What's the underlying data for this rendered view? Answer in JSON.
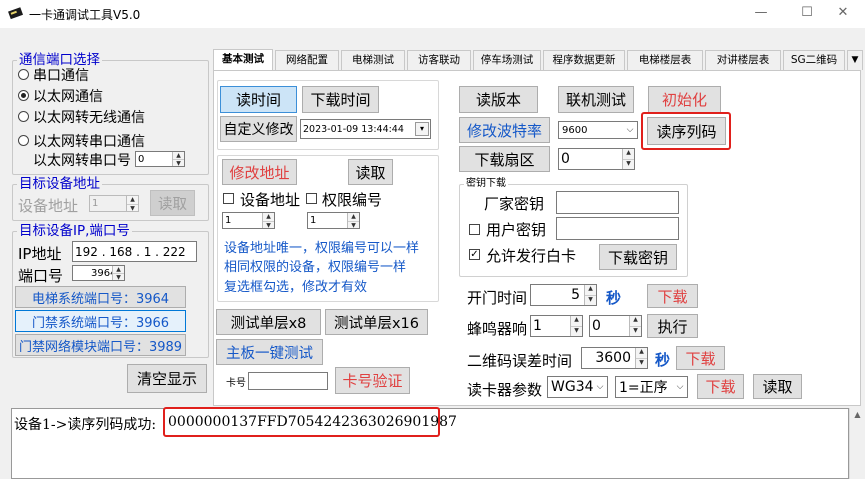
{
  "window": {
    "title": "一卡通调试工具V5.0",
    "minimize": "—",
    "maximize": "☐",
    "close": "✕"
  },
  "left": {
    "comm_group": "通信端口选择",
    "comm_options": [
      "串口通信",
      "以太网通信",
      "以太网转无线通信",
      "以太网转串口通信"
    ],
    "selected_option_index": 1,
    "serial_port_label": "以太网转串口号",
    "serial_port_value": "0",
    "target_group": "目标设备地址",
    "device_addr_label": "设备地址",
    "device_addr_value": "1",
    "read_btn": "读取",
    "ip_group": "目标设备IP,端口号",
    "ip_label": "IP地址",
    "ip_value": "192 . 168 .  1  . 222",
    "port_label": "端口号",
    "port_value": "3964",
    "btn_elevator_port": "电梯系统端口号：3964",
    "btn_access_port": "门禁系统端口号：3966",
    "btn_network_port": "门禁网络模块端口号：3989",
    "clear_btn": "清空显示"
  },
  "tabs": [
    "基本测试",
    "网络配置",
    "电梯测试",
    "访客联动",
    "停车场测试",
    "程序数据更新",
    "电梯楼层表",
    "对讲楼层表",
    "SG二维码"
  ],
  "active_tab": 0,
  "tab_overflow_icon": "chevron-down-icon",
  "main": {
    "read_time": "读时间",
    "download_time": "下载时间",
    "custom_modify": "自定义修改",
    "datetime_value": "2023-01-09 13:44:44",
    "modify_addr": "修改地址",
    "read2": "读取",
    "chk_device_addr": "设备地址",
    "chk_perm_no": "权限编号",
    "addr_spin_value": "1",
    "perm_spin_value": "1",
    "hint1": "设备地址唯一，权限编号可以一样",
    "hint2": "相同权限的设备，权限编号一样",
    "hint3": "复选框勾选，修改才有效",
    "test_single_x8": "测试单层x8",
    "test_single_x16": "测试单层x16",
    "mainboard_test": "主板一键测试",
    "card_label": "卡号",
    "card_value": "",
    "card_verify": "卡号验证",
    "read_version": "读版本",
    "online_test": "联机测试",
    "initialize": "初始化",
    "modify_baud": "修改波特率",
    "baud_value": "9600",
    "read_serial": "读序列码",
    "download_sector": "下载扇区",
    "sector_value": "0",
    "key_group": "密钥下载",
    "vendor_key": "厂家密钥",
    "user_key": "用户密钥",
    "allow_whitecard": "允许发行白卡",
    "download_key": "下载密钥",
    "open_time_label": "开门时间",
    "open_time_value": "5",
    "sec_unit": "秒",
    "download1": "下载",
    "buzzer_label": "蜂鸣器响",
    "buzzer_a": "1",
    "buzzer_b": "0",
    "execute": "执行",
    "qr_err_label": "二维码误差时间",
    "qr_err_value": "3600",
    "sec_unit2": "秒",
    "download2": "下载",
    "reader_param_label": "读卡器参数",
    "reader_format": "WG34",
    "reader_order": "1=正序",
    "download3": "下载",
    "read3": "读取"
  },
  "log": {
    "prefix": "设备1->读序列码成功:",
    "serial": "0000000137FFD7054242363026901987"
  },
  "colors": {
    "highlight_red": "#e0201c",
    "blue_text": "#1558c8",
    "red_text": "#e04040"
  }
}
